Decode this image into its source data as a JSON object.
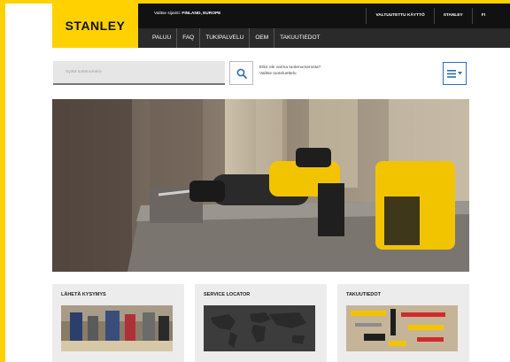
{
  "brand": {
    "logo_text": "STANLEY",
    "accent_color": "#ffd100",
    "dark_bar": "#111111",
    "nav_bar": "#2a2a2a",
    "link_blue": "#2d6fb8"
  },
  "region": {
    "label": "Valitse sijainti:",
    "value": "FINLAND, EUROPE"
  },
  "top_links": [
    "VALTUUTETTU KÄYTTÖ",
    "STANLEY",
    "FI"
  ],
  "nav": [
    "PALUU",
    "FAQ",
    "TUKIPALVELU",
    "OEM",
    "TAKUUTIEDOT"
  ],
  "search": {
    "placeholder": "Syötä tuotenumero",
    "icon": "search-icon"
  },
  "help": {
    "line1": "Etkö ole varma tuotenumerosta?",
    "line2": "Valitse tuoteluettelo"
  },
  "menu": {
    "icon": "hamburger-menu-icon"
  },
  "cards": [
    {
      "title": "LÄHETÄ KYSYMYS"
    },
    {
      "title": "SERVICE LOCATOR"
    },
    {
      "title": "TAKUUTIEDOT"
    }
  ]
}
